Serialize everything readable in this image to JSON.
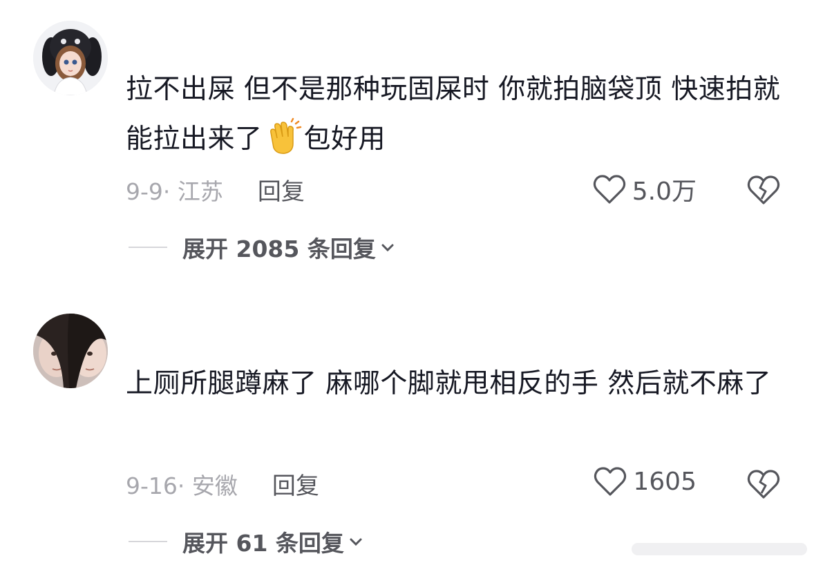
{
  "comments": [
    {
      "avatar": "anime-girl-bunny-hood-avatar",
      "text_part1": "拉不出屎 但不是那种玩固屎时 你就拍脑袋顶 快速拍就能拉出来了",
      "emoji": "clapping-hands-emoji",
      "text_part2": "包好用",
      "date_location": "9-9· 江苏",
      "reply_label": "回复",
      "likes": "5.0万",
      "expand_label": "展开 2085 条回复"
    },
    {
      "avatar": "two-people-photo-avatar",
      "text": "上厕所腿蹲麻了 麻哪个脚就甩相反的手 然后就不麻了",
      "date_location": "9-16· 安徽",
      "reply_label": "回复",
      "likes": "1605",
      "expand_label": "展开 61 条回复"
    }
  ],
  "colors": {
    "text": "#161823",
    "meta": "#a7a7ad",
    "action": "#55565c",
    "divider": "#d6d6da"
  }
}
